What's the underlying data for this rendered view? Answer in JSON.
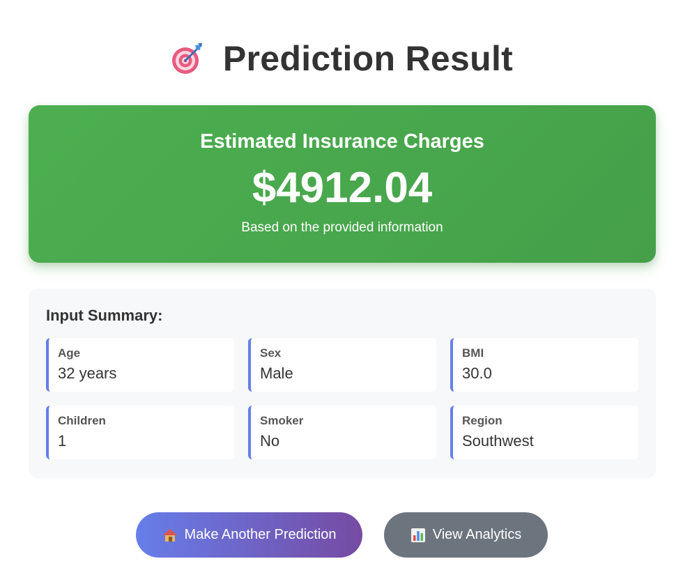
{
  "header": {
    "icon": "target-icon",
    "title": "Prediction Result"
  },
  "result": {
    "heading": "Estimated Insurance Charges",
    "amount": "$4912.04",
    "note": "Based on the provided information",
    "colors": {
      "start": "#4caf50",
      "end": "#45a049"
    }
  },
  "summary": {
    "title": "Input Summary:",
    "items": [
      {
        "label": "Age",
        "value": "32 years"
      },
      {
        "label": "Sex",
        "value": "Male"
      },
      {
        "label": "BMI",
        "value": "30.0"
      },
      {
        "label": "Children",
        "value": "1"
      },
      {
        "label": "Smoker",
        "value": "No"
      },
      {
        "label": "Region",
        "value": "Southwest"
      }
    ],
    "accent_color": "#667eea"
  },
  "actions": {
    "primary": {
      "icon": "house-icon",
      "label": "Make Another Prediction"
    },
    "secondary": {
      "icon": "bar-chart-icon",
      "label": "View Analytics"
    }
  }
}
